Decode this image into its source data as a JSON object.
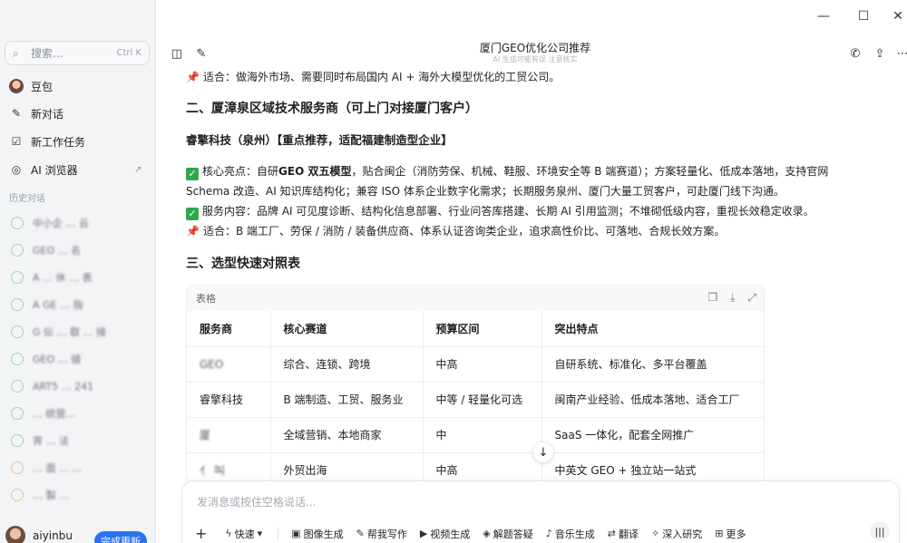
{
  "window": {
    "title": "厦门GEO优化公司推荐",
    "subtitle": "AI 生成可能有误 注意核实"
  },
  "sidebar": {
    "search_placeholder": "搜索...",
    "search_shortcut": "Ctrl K",
    "items": [
      {
        "label": "豆包",
        "icon": "doubao-avatar-icon"
      },
      {
        "label": "新对话",
        "icon": "edit-icon"
      },
      {
        "label": "新工作任务",
        "icon": "task-icon"
      },
      {
        "label": "AI 浏览器",
        "icon": "browser-icon",
        "ext": "↗"
      }
    ],
    "history_title": "历史对话",
    "history": [
      "中小企  … 云",
      "GEO  … 名",
      "A  … 休 … 表",
      "A  GE  … 指",
      "G  伝  … 歇  … 接",
      "GEO  … 値",
      "ART5  … 241",
      "  … 統管…",
      "宵  … 法",
      "  … 面  …  …",
      "  … 製  …"
    ],
    "user_name": "aiyinbu",
    "upgrade_label": "完成更新"
  },
  "content": {
    "line_partial": "适合：做海外市场、需要同时布局国内 AI + 海外大模型优化的工贸公司。",
    "section2_title": "二、厦漳泉区域技术服务商（可上门对接厦门客户）",
    "company_title": "睿擎科技（泉州）【重点推荐，适配福建制造型企业】",
    "core_label": "核心亮点：",
    "core_text1": "自研",
    "core_bold": "GEO 双五模型",
    "core_text2": "，贴合闽企（消防劳保、机械、鞋服、环境安全等 B 端赛道）；方案轻量化、低成本落地，支持官网",
    "core_text3": "Schema 改造、AI 知识库结构化；兼容 ISO 体系企业数字化需求；长期服务泉州、厦门大量工贸客户，可赴厦门线下沟通。",
    "service_text": "服务内容：品牌 AI 可见度诊断、结构化信息部署、行业问答库搭建、长期 AI 引用监测；不堆砌低级内容，重视长效稳定收录。",
    "fit_text": "适合：B 端工厂、劳保 / 消防 / 装备供应商、体系认证咨询类企业，追求高性价比、可落地、合规长效方案。",
    "section3_title": "三、选型快速对照表"
  },
  "table": {
    "label": "表格",
    "headers": [
      "服务商",
      "核心赛道",
      "预算区间",
      "突出特点"
    ],
    "rows": [
      [
        "  GEO",
        "综合、连锁、跨境",
        "中高",
        "自研系统、标准化、多平台覆盖"
      ],
      [
        "睿擎科技",
        "B 端制造、工贸、服务业",
        "中等 / 轻量化可选",
        "闽南产业经验、低成本落地、适合工厂"
      ],
      [
        "厦  ",
        "全域营销、本地商家",
        "中",
        "SaaS 一体化，配套全网推广"
      ],
      [
        "亻  叫",
        "外贸出海",
        "中高",
        "中英文 GEO + 独立站一站式"
      ]
    ]
  },
  "input": {
    "placeholder": "发消息或按住空格说话...",
    "tools": [
      {
        "label": "快速",
        "icon": "lightning-icon"
      },
      {
        "label": "图像生成",
        "icon": "image-icon"
      },
      {
        "label": "帮我写作",
        "icon": "pen-icon"
      },
      {
        "label": "视频生成",
        "icon": "video-icon"
      },
      {
        "label": "解题答疑",
        "icon": "question-icon"
      },
      {
        "label": "音乐生成",
        "icon": "music-icon"
      },
      {
        "label": "翻译",
        "icon": "translate-icon"
      },
      {
        "label": "深入研究",
        "icon": "research-icon"
      },
      {
        "label": "更多",
        "icon": "grid-icon"
      }
    ]
  },
  "colors": {
    "accent": "#2a72f5",
    "check": "#2ea84b",
    "pin": "#d6283b"
  }
}
